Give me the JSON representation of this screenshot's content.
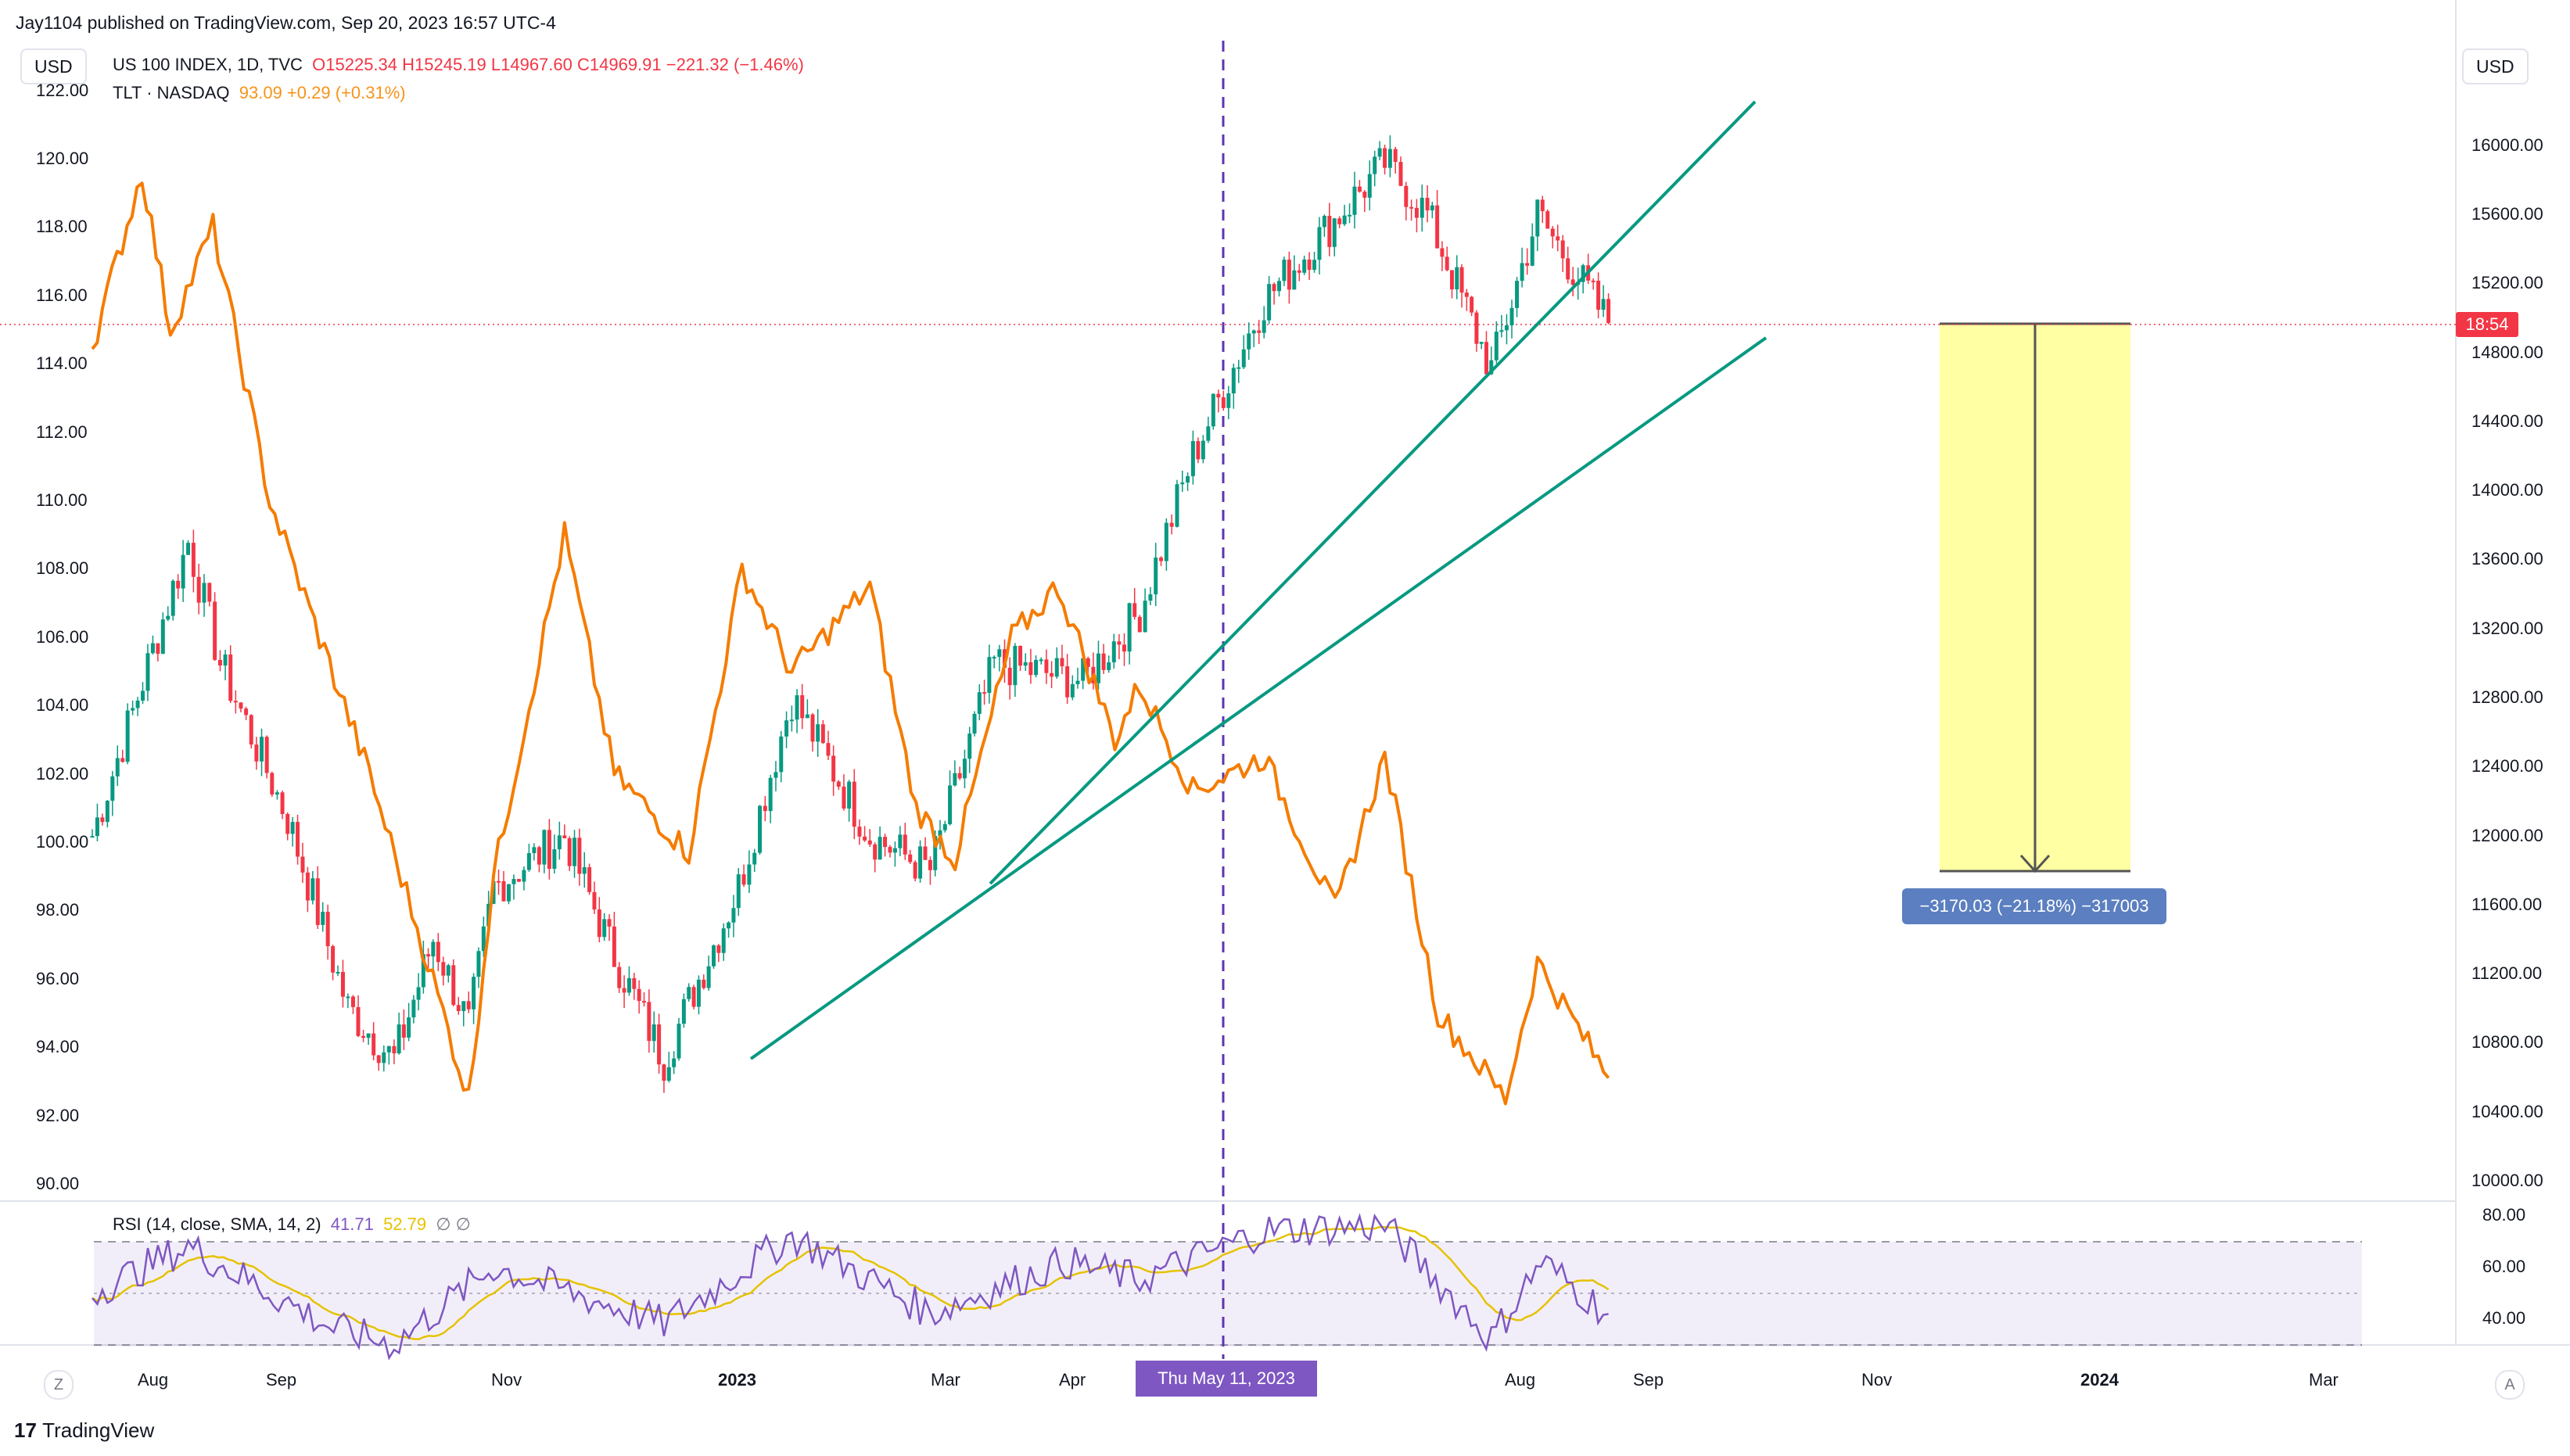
{
  "header": {
    "published_by": "Jay1104 published on TradingView.com, Sep 20, 2023 16:57 UTC-4",
    "currency_left": "USD",
    "currency_right": "USD"
  },
  "legend": {
    "main_symbol": "US 100 INDEX, 1D, TVC",
    "main_ohlc": "O15225.34  H15245.19  L14967.60  C14969.91  −221.32 (−1.46%)",
    "compare_symbol": "TLT · NASDAQ",
    "compare_values": "93.09  +0.29 (+0.31%)"
  },
  "rsi_legend": {
    "label": "RSI (14, close, SMA, 14, 2)",
    "value_rsi": "41.71",
    "value_sma": "52.79",
    "extra": "∅  ∅"
  },
  "price_tag": "18:54",
  "date_tag": "Thu May 11, 2023",
  "measure_label": "−3170.03 (−21.18%) −317003",
  "branding": "TradingView",
  "buttons": {
    "goto_start": "Z",
    "auto_scale": "A"
  },
  "colors": {
    "up": "#089981",
    "down": "#f23645",
    "tlt": "#f57c00",
    "trendline": "#089981",
    "rsi": "#7e57c2",
    "rsi_sma": "#e6c200",
    "measure_fill": "#ffff99",
    "vline": "#5e35b1"
  },
  "chart_data": {
    "type": "line",
    "title": "US 100 INDEX, 1D, TVC",
    "ohlc_summary": {
      "open": 15225.34,
      "high": 15245.19,
      "low": 14967.6,
      "close": 14969.91
    },
    "x_ticks": [
      "Aug",
      "Sep",
      "Nov",
      "2023",
      "Mar",
      "Apr",
      "May",
      "Aug",
      "Sep",
      "Nov",
      "2024",
      "Mar"
    ],
    "y_left_ticks": [
      "90.00",
      "92.00",
      "94.00",
      "96.00",
      "98.00",
      "100.00",
      "102.00",
      "104.00",
      "106.00",
      "108.00",
      "110.00",
      "112.00",
      "114.00",
      "116.00",
      "118.00",
      "120.00",
      "122.00"
    ],
    "y_right_ticks": [
      "10000.00",
      "10400.00",
      "10800.00",
      "11200.00",
      "11600.00",
      "12000.00",
      "12400.00",
      "12800.00",
      "13200.00",
      "13600.00",
      "14000.00",
      "14400.00",
      "14800.00",
      "15200.00",
      "15600.00",
      "16000.00"
    ],
    "rsi_ticks": [
      "40.00",
      "60.00",
      "80.00"
    ],
    "y_left_range": [
      90,
      122
    ],
    "y_right_range": [
      10000,
      16000
    ],
    "series": [
      {
        "name": "US 100 INDEX",
        "style": "candles",
        "x": [
          "2022-07-20",
          "2022-08-16",
          "2022-08-25",
          "2022-09-13",
          "2022-09-30",
          "2022-10-13",
          "2022-10-24",
          "2022-11-03",
          "2022-11-10",
          "2022-11-30",
          "2022-12-14",
          "2022-12-28",
          "2023-01-18",
          "2023-02-02",
          "2023-02-24",
          "2023-03-13",
          "2023-03-31",
          "2023-04-25",
          "2023-05-11",
          "2023-05-26",
          "2023-06-15",
          "2023-07-19",
          "2023-07-31",
          "2023-08-18",
          "2023-08-31",
          "2023-09-20"
        ],
        "values": [
          12000,
          13700,
          13000,
          12100,
          11000,
          10700,
          11400,
          10900,
          11700,
          12000,
          11300,
          10700,
          11700,
          12800,
          12000,
          11800,
          13000,
          12900,
          13300,
          14200,
          15100,
          15900,
          15600,
          14700,
          15600,
          14970
        ]
      },
      {
        "name": "TLT · NASDAQ",
        "style": "line",
        "x": [
          "2022-07-20",
          "2022-08-03",
          "2022-08-11",
          "2022-08-23",
          "2022-09-08",
          "2022-09-22",
          "2022-10-06",
          "2022-10-21",
          "2022-11-03",
          "2022-11-10",
          "2022-11-30",
          "2022-12-14",
          "2023-01-04",
          "2023-01-19",
          "2023-02-02",
          "2023-02-24",
          "2023-03-09",
          "2023-03-20",
          "2023-04-05",
          "2023-04-18",
          "2023-05-04",
          "2023-05-11",
          "2023-05-26",
          "2023-06-15",
          "2023-07-05",
          "2023-07-19",
          "2023-08-03",
          "2023-08-22",
          "2023-08-31",
          "2023-09-20"
        ],
        "values": [
          114.5,
          119.6,
          115,
          118,
          110,
          106,
          102,
          97,
          92.5,
          99,
          109,
          102,
          99.7,
          108,
          105,
          107.5,
          101,
          99.5,
          106,
          107.5,
          103,
          104.6,
          101.5,
          102.5,
          98,
          102.5,
          95,
          92.5,
          96.5,
          93.1
        ]
      },
      {
        "name": "RSI (14, close, SMA, 14, 2)",
        "style": "oscillator",
        "x": [
          "2022-07-20",
          "2022-08-16",
          "2022-09-26",
          "2022-10-13",
          "2022-11-10",
          "2022-12-28",
          "2023-02-02",
          "2023-03-13",
          "2023-04-20",
          "2023-05-11",
          "2023-06-15",
          "2023-07-19",
          "2023-08-18",
          "2023-09-01",
          "2023-09-20"
        ],
        "values": [
          50,
          68,
          36,
          30,
          60,
          38,
          72,
          42,
          62,
          55,
          74,
          76,
          32,
          62,
          41.71
        ]
      }
    ]
  }
}
